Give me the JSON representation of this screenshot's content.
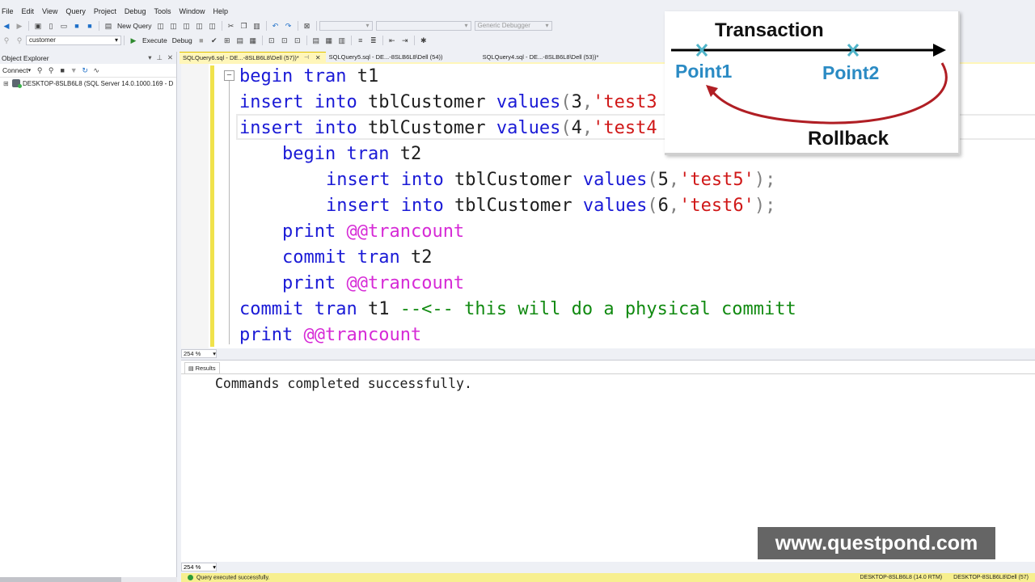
{
  "menu": [
    "File",
    "Edit",
    "View",
    "Query",
    "Project",
    "Debug",
    "Tools",
    "Window",
    "Help"
  ],
  "toolbar1": {
    "new_query": "New Query",
    "solution_platform": "",
    "debugger": "Generic Debugger"
  },
  "toolbar2": {
    "database": "customer",
    "execute": "Execute",
    "debug": "Debug"
  },
  "object_explorer": {
    "title": "Object Explorer",
    "connect": "Connect",
    "server_node": "DESKTOP-8SLB6L8 (SQL Server 14.0.1000.169 - D"
  },
  "tabs": [
    {
      "label": "SQLQuery6.sql - DE...-8SLB6L8\\Dell (57))*",
      "active": true
    },
    {
      "label": "SQLQuery5.sql - DE...-8SLB6L8\\Dell (54))",
      "active": false
    },
    {
      "label": "SQLQuery4.sql - DE...-8SLB6L8\\Dell (53))*",
      "active": false
    }
  ],
  "code": {
    "l1": {
      "kw1": "begin tran",
      "txt": " t1"
    },
    "l2": {
      "kw1": "insert into",
      "txt": " tblCustomer ",
      "kw2": "values",
      "p1": "(",
      "num": "3",
      "p2": ",",
      "str": "'test3"
    },
    "l3": {
      "kw1": "insert into",
      "txt": " tblCustomer ",
      "kw2": "values",
      "p1": "(",
      "num": "4",
      "p2": ",",
      "str": "'test4"
    },
    "l4": {
      "kw1": "begin tran",
      "txt": " t2"
    },
    "l5": {
      "kw1": "insert into",
      "txt": " tblCustomer ",
      "kw2": "values",
      "p1": "(",
      "num": "5",
      "p2": ",",
      "str": "'test5'",
      "p3": ");"
    },
    "l6": {
      "kw1": "insert into",
      "txt": " tblCustomer ",
      "kw2": "values",
      "p1": "(",
      "num": "6",
      "p2": ",",
      "str": "'test6'",
      "p3": ");"
    },
    "l7": {
      "kw1": "print",
      "var": "@@trancount"
    },
    "l8": {
      "kw1": "commit tran",
      "txt": " t2"
    },
    "l9": {
      "kw1": "print",
      "var": "@@trancount"
    },
    "l10": {
      "kw1": "commit tran",
      "txt": " t1 ",
      "cmt": "--<-- this will do a physical committ"
    },
    "l11": {
      "kw1": "print",
      "var": "@@trancount"
    }
  },
  "zoom": "254 %",
  "results": {
    "tab": "Results",
    "message": "Commands completed successfully."
  },
  "status": {
    "message": "Query executed successfully.",
    "server": "DESKTOP-8SLB6L8 (14.0 RTM)",
    "user": "DESKTOP-8SLB6L8\\Dell (57)"
  },
  "diagram": {
    "title": "Transaction",
    "point1": "Point1",
    "point2": "Point2",
    "rollback": "Rollback",
    "arrow_color": "#b01e24",
    "marker_color": "#4fb3c8"
  },
  "watermark": "www.questpond.com"
}
